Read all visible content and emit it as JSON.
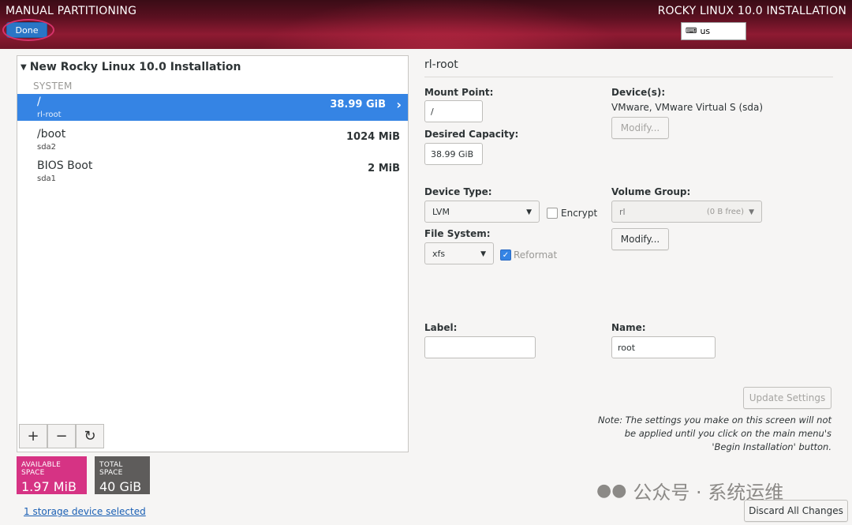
{
  "header": {
    "title_left": "MANUAL PARTITIONING",
    "title_right": "ROCKY LINUX 10.0 INSTALLATION",
    "done_label": "Done",
    "keyboard_layout": "us",
    "keyboard_icon": "keyboard-icon"
  },
  "partitions": {
    "group_title": "New Rocky Linux 10.0 Installation",
    "section_label": "SYSTEM",
    "items": [
      {
        "name": "/",
        "device": "rl-root",
        "size": "38.99 GiB",
        "selected": true
      },
      {
        "name": "/boot",
        "device": "sda2",
        "size": "1024 MiB",
        "selected": false
      },
      {
        "name": "BIOS Boot",
        "device": "sda1",
        "size": "2 MiB",
        "selected": false
      }
    ],
    "toolbar": {
      "add": "+",
      "remove": "−",
      "refresh": "↻"
    }
  },
  "space": {
    "available_label": "AVAILABLE SPACE",
    "available_value": "1.97 MiB",
    "total_label": "TOTAL SPACE",
    "total_value": "40 GiB"
  },
  "storage_link": "1 storage device selected",
  "details": {
    "title": "rl-root",
    "mount_point_label": "Mount Point:",
    "mount_point_value": "/",
    "capacity_label": "Desired Capacity:",
    "capacity_value": "38.99 GiB",
    "devices_label": "Device(s):",
    "devices_value": "VMware, VMware Virtual S (sda)",
    "modify_label": "Modify...",
    "device_type_label": "Device Type:",
    "device_type_value": "LVM",
    "encrypt_label": "Encrypt",
    "volume_group_label": "Volume Group:",
    "volume_group_value": "rl",
    "volume_group_free": "(0 B free)",
    "file_system_label": "File System:",
    "file_system_value": "xfs",
    "reformat_label": "Reformat",
    "label_label": "Label:",
    "label_value": "",
    "name_label": "Name:",
    "name_value": "root",
    "update_label": "Update Settings",
    "note": "Note:  The settings you make on this screen will not be applied until you click on the main menu's 'Begin Installation' button.",
    "discard_label": "Discard All Changes"
  },
  "watermark": "公众号 · 系统运维",
  "colors": {
    "selected_row": "#3584e4",
    "available": "#d63384",
    "total": "#5e5c5b",
    "done_ring": "#d6336c"
  }
}
